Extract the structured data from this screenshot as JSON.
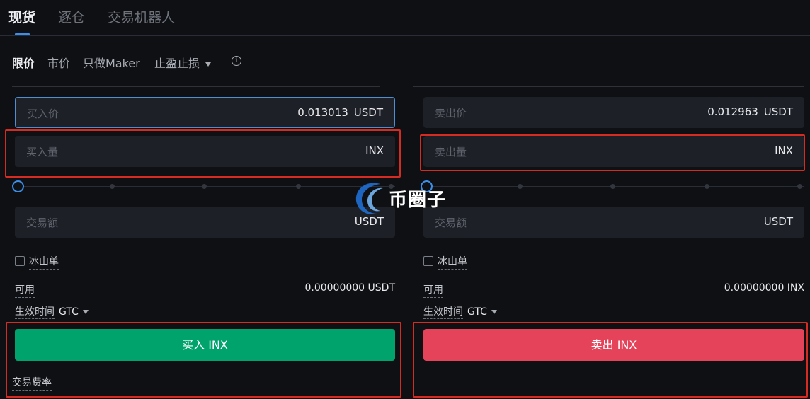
{
  "top_tabs": [
    "现货",
    "逐仓",
    "交易机器人"
  ],
  "order_types": {
    "limit": "限价",
    "market": "市价",
    "maker_only": "只做Maker",
    "tp_sl": "止盈止损"
  },
  "buy": {
    "price_label": "买入价",
    "price_value": "0.013013",
    "price_unit": "USDT",
    "amount_label": "买入量",
    "amount_unit": "INX",
    "total_label": "交易额",
    "total_unit": "USDT",
    "iceberg_label": "冰山单",
    "available_label": "可用",
    "available_value": "0.00000000 USDT",
    "tif_label": "生效时间",
    "tif_value": "GTC",
    "button_label": "买入 INX",
    "slider_percent": 0
  },
  "sell": {
    "price_label": "卖出价",
    "price_value": "0.012963",
    "price_unit": "USDT",
    "amount_label": "卖出量",
    "amount_unit": "INX",
    "total_label": "交易额",
    "total_unit": "USDT",
    "iceberg_label": "冰山单",
    "available_label": "可用",
    "available_value": "0.00000000 INX",
    "tif_label": "生效时间",
    "tif_value": "GTC",
    "button_label": "卖出 INX",
    "slider_percent": 0
  },
  "fee_label": "交易费率",
  "watermark_text": "币圈子",
  "colors": {
    "buy": "#00a36c",
    "sell": "#e5435a",
    "accent": "#3b8fe8",
    "highlight": "#d42b22"
  }
}
